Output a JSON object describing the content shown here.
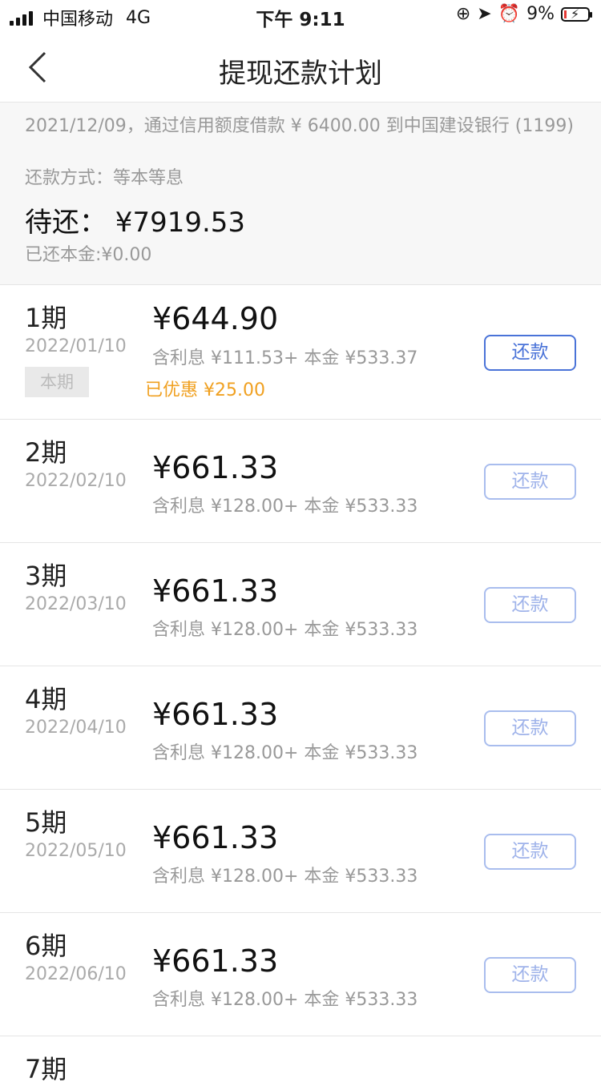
{
  "status": {
    "carrier": "中国移动",
    "network": "4G",
    "time": "下午 9:11",
    "battery": "9%"
  },
  "nav": {
    "title": "提现还款计划"
  },
  "summary": {
    "description": "2021/12/09，通过信用额度借款 ¥ 6400.00 到中国建设银行 (1199)",
    "method": "还款方式：等本等息",
    "pending": "待还： ¥7919.53",
    "paid_principal": "已还本金:¥0.00"
  },
  "installments": [
    {
      "period": "1期",
      "date": "2022/01/10",
      "badge": "本期",
      "amount": "¥644.90",
      "detail": "含利息 ¥111.53+ 本金 ¥533.37",
      "discount": "已优惠 ¥25.00",
      "button": "还款",
      "enabled": true
    },
    {
      "period": "2期",
      "date": "2022/02/10",
      "amount": "¥661.33",
      "detail": "含利息 ¥128.00+ 本金 ¥533.33",
      "button": "还款",
      "enabled": false
    },
    {
      "period": "3期",
      "date": "2022/03/10",
      "amount": "¥661.33",
      "detail": "含利息 ¥128.00+ 本金 ¥533.33",
      "button": "还款",
      "enabled": false
    },
    {
      "period": "4期",
      "date": "2022/04/10",
      "amount": "¥661.33",
      "detail": "含利息 ¥128.00+ 本金 ¥533.33",
      "button": "还款",
      "enabled": false
    },
    {
      "period": "5期",
      "date": "2022/05/10",
      "amount": "¥661.33",
      "detail": "含利息 ¥128.00+ 本金 ¥533.33",
      "button": "还款",
      "enabled": false
    },
    {
      "period": "6期",
      "date": "2022/06/10",
      "amount": "¥661.33",
      "detail": "含利息 ¥128.00+ 本金 ¥533.33",
      "button": "还款",
      "enabled": false
    },
    {
      "period": "7期"
    }
  ],
  "colors": {
    "accent": "#4a73d8",
    "accent_disabled": "#a9bdee",
    "discount": "#f0a020"
  }
}
